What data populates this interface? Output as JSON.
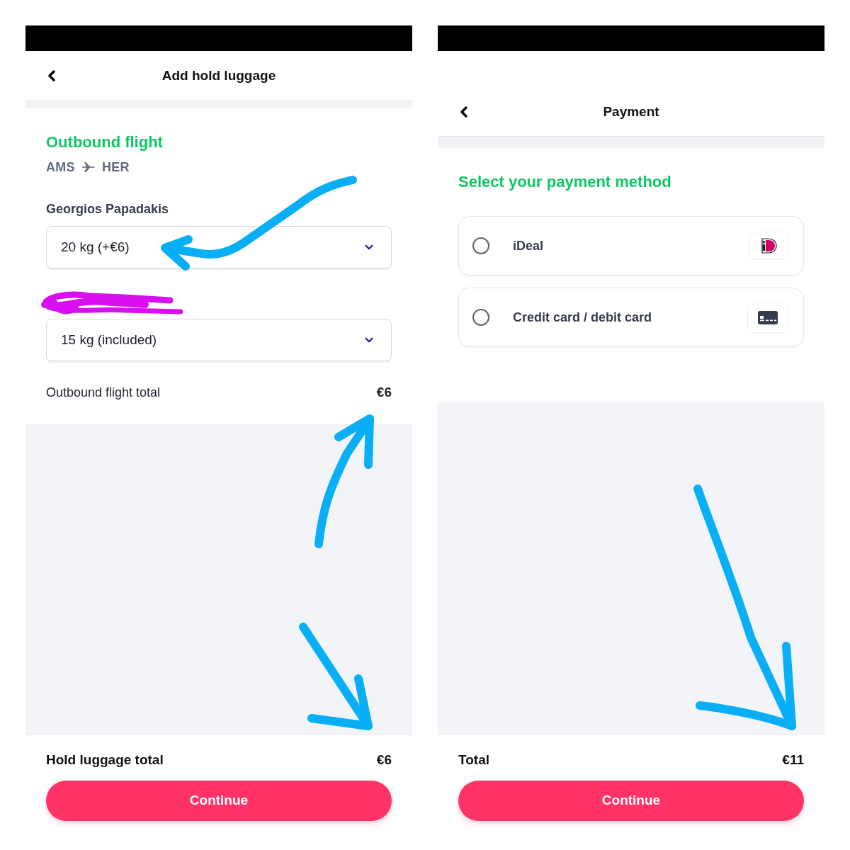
{
  "screens": [
    {
      "kind": "luggage",
      "title": "Add hold luggage",
      "section": {
        "heading": "Outbound flight",
        "route": {
          "from": "AMS",
          "to": "HER"
        },
        "passengers": [
          {
            "name": "Georgios Papadakis",
            "name_redacted": false,
            "baggage": "20 kg (+€6)"
          },
          {
            "name_redacted": true,
            "baggage": "15 kg (included)"
          }
        ],
        "subtotal": {
          "label": "Outbound flight total",
          "amount": "€6"
        }
      },
      "total": {
        "label": "Hold luggage total",
        "amount": "€6"
      },
      "button": "Continue"
    },
    {
      "kind": "payment",
      "title": "Payment",
      "heading": "Select your payment method",
      "methods": [
        {
          "kind": "ideal",
          "label": "iDeal",
          "selected": false
        },
        {
          "kind": "card",
          "label": "Credit card / debit card",
          "selected": false
        }
      ],
      "total": {
        "label": "Total",
        "amount": "€11"
      },
      "button": "Continue"
    }
  ]
}
